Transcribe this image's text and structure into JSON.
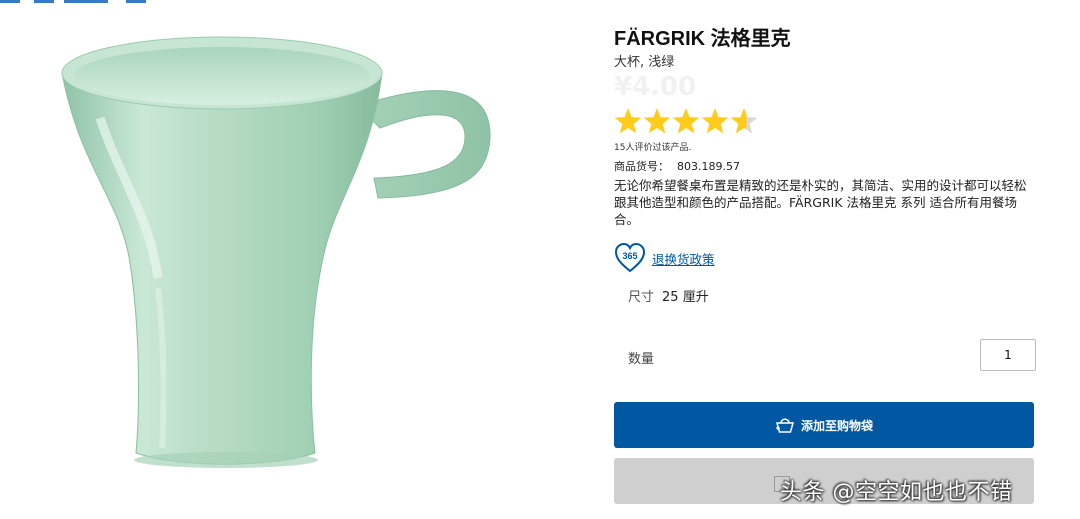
{
  "colors": {
    "accent": "#0058a3",
    "star": "#ffcc1c",
    "star_empty": "#d9d9d9",
    "mug": "#b8dcc6"
  },
  "product": {
    "title": "FÄRGRIK 法格里克",
    "subtitle": "大杯, 浅绿",
    "price": "¥4.00",
    "rating": {
      "value": 4.6,
      "max": 5
    },
    "review_count_text": "15人评价过该产品.",
    "article_label": "商品货号：",
    "article_number": "803.189.57",
    "description": "无论你希望餐桌布置是精致的还是朴实的，其简洁、实用的设计都可以轻松跟其他造型和颜色的产品搭配。FÄRGRIK 法格里克 系列 适合所有用餐场合。",
    "policy_badge": "365",
    "policy_link": "退换货政策",
    "size_label": "尺寸",
    "size_value": "25 厘升",
    "quantity_label": "数量",
    "quantity_value": "1",
    "add_to_bag": "添加至购物袋",
    "icons": {
      "policy": "heart-365-icon",
      "bag": "shopping-bag-icon"
    }
  },
  "watermark": "头条 @空空如也也不错"
}
